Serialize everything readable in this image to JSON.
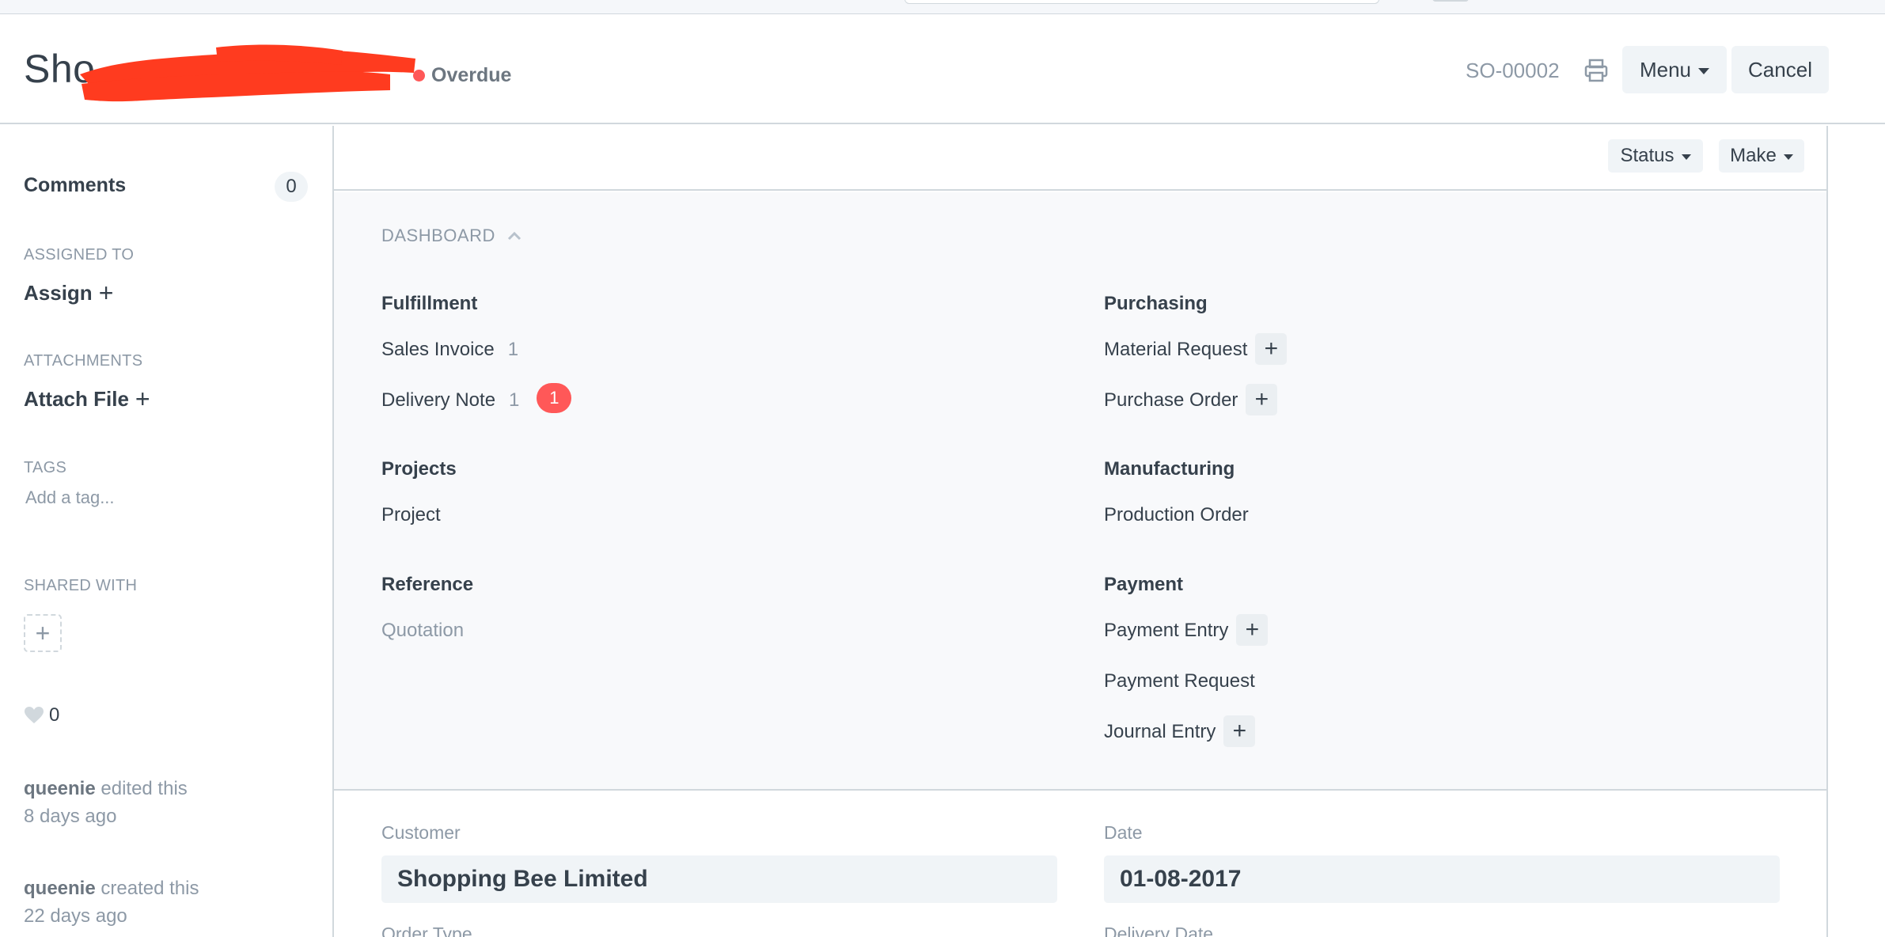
{
  "header": {
    "title": "Sho",
    "status": "Overdue",
    "status_color": "#ff5858",
    "doc_name": "SO-00002",
    "print_icon": "printer-icon",
    "menu_label": "Menu",
    "cancel_label": "Cancel"
  },
  "sidebar": {
    "comments_label": "Comments",
    "comments_count": "0",
    "assigned_to_label": "ASSIGNED TO",
    "assign_label": "Assign",
    "attachments_label": "ATTACHMENTS",
    "attach_label": "Attach File",
    "tags_label": "TAGS",
    "add_tag_placeholder": "Add a tag...",
    "shared_with_label": "SHARED WITH",
    "likes_count": "0",
    "timeline": [
      {
        "user": "queenie",
        "action": "edited this",
        "when": "8 days ago"
      },
      {
        "user": "queenie",
        "action": "created this",
        "when": "22 days ago"
      }
    ]
  },
  "toolbar": {
    "status_label": "Status",
    "make_label": "Make"
  },
  "dashboard": {
    "title": "DASHBOARD",
    "groups": [
      {
        "title": "Fulfillment",
        "links": [
          {
            "label": "Sales Invoice",
            "count": "1"
          },
          {
            "label": "Delivery Note",
            "count": "1",
            "badge": "1"
          }
        ]
      },
      {
        "title": "Projects",
        "links": [
          {
            "label": "Project"
          }
        ]
      },
      {
        "title": "Reference",
        "links": [
          {
            "label": "Quotation"
          }
        ]
      },
      {
        "title": "Purchasing",
        "links": [
          {
            "label": "Material Request"
          },
          {
            "label": "Purchase Order"
          }
        ]
      },
      {
        "title": "Manufacturing",
        "links": [
          {
            "label": "Production Order"
          }
        ]
      },
      {
        "title": "Payment",
        "links": [
          {
            "label": "Payment Entry"
          },
          {
            "label": "Payment Request"
          },
          {
            "label": "Journal Entry"
          }
        ]
      }
    ]
  },
  "form": {
    "customer_label": "Customer",
    "customer_value": "Shopping Bee Limited",
    "date_label": "Date",
    "date_value": "01-08-2017",
    "order_type_label": "Order Type",
    "delivery_date_label": "Delivery Date"
  }
}
